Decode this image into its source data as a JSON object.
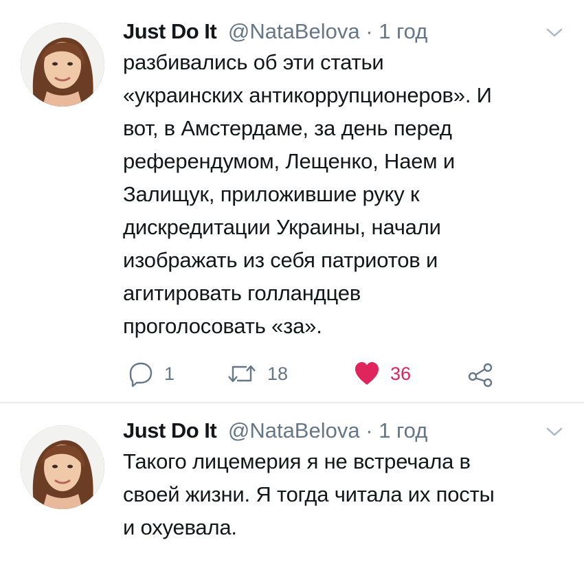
{
  "tweets": [
    {
      "name": "Just Do It",
      "handle": "@NataBelova",
      "dot": "·",
      "time": "1 год",
      "lines": [
        "разбивались об эти статьи",
        "«украинских антикоррупционеров». И",
        "вот, в Амстердаме, за день перед",
        "референдумом, Лещенко, Наем и",
        "Залищук, приложившие руку к",
        "дискредитации Украины, начали",
        "изображать из себя патриотов и",
        "агитировать голландцев",
        "проголосовать «за»."
      ],
      "replies": "1",
      "retweets": "18",
      "likes": "36"
    },
    {
      "name": "Just Do It",
      "handle": "@NataBelova",
      "dot": "·",
      "time": "1 год",
      "lines": [
        "Такого лицемерия я не встречала в",
        "своей жизни. Я тогда читала их посты",
        "и охуевала."
      ]
    }
  ],
  "colors": {
    "text": "#14171a",
    "secondary": "#657786",
    "like": "#e0245e",
    "divider": "#e6ecf0"
  },
  "icons": [
    "reply-icon",
    "retweet-icon",
    "heart-icon",
    "share-icon",
    "chevron-down-icon"
  ]
}
